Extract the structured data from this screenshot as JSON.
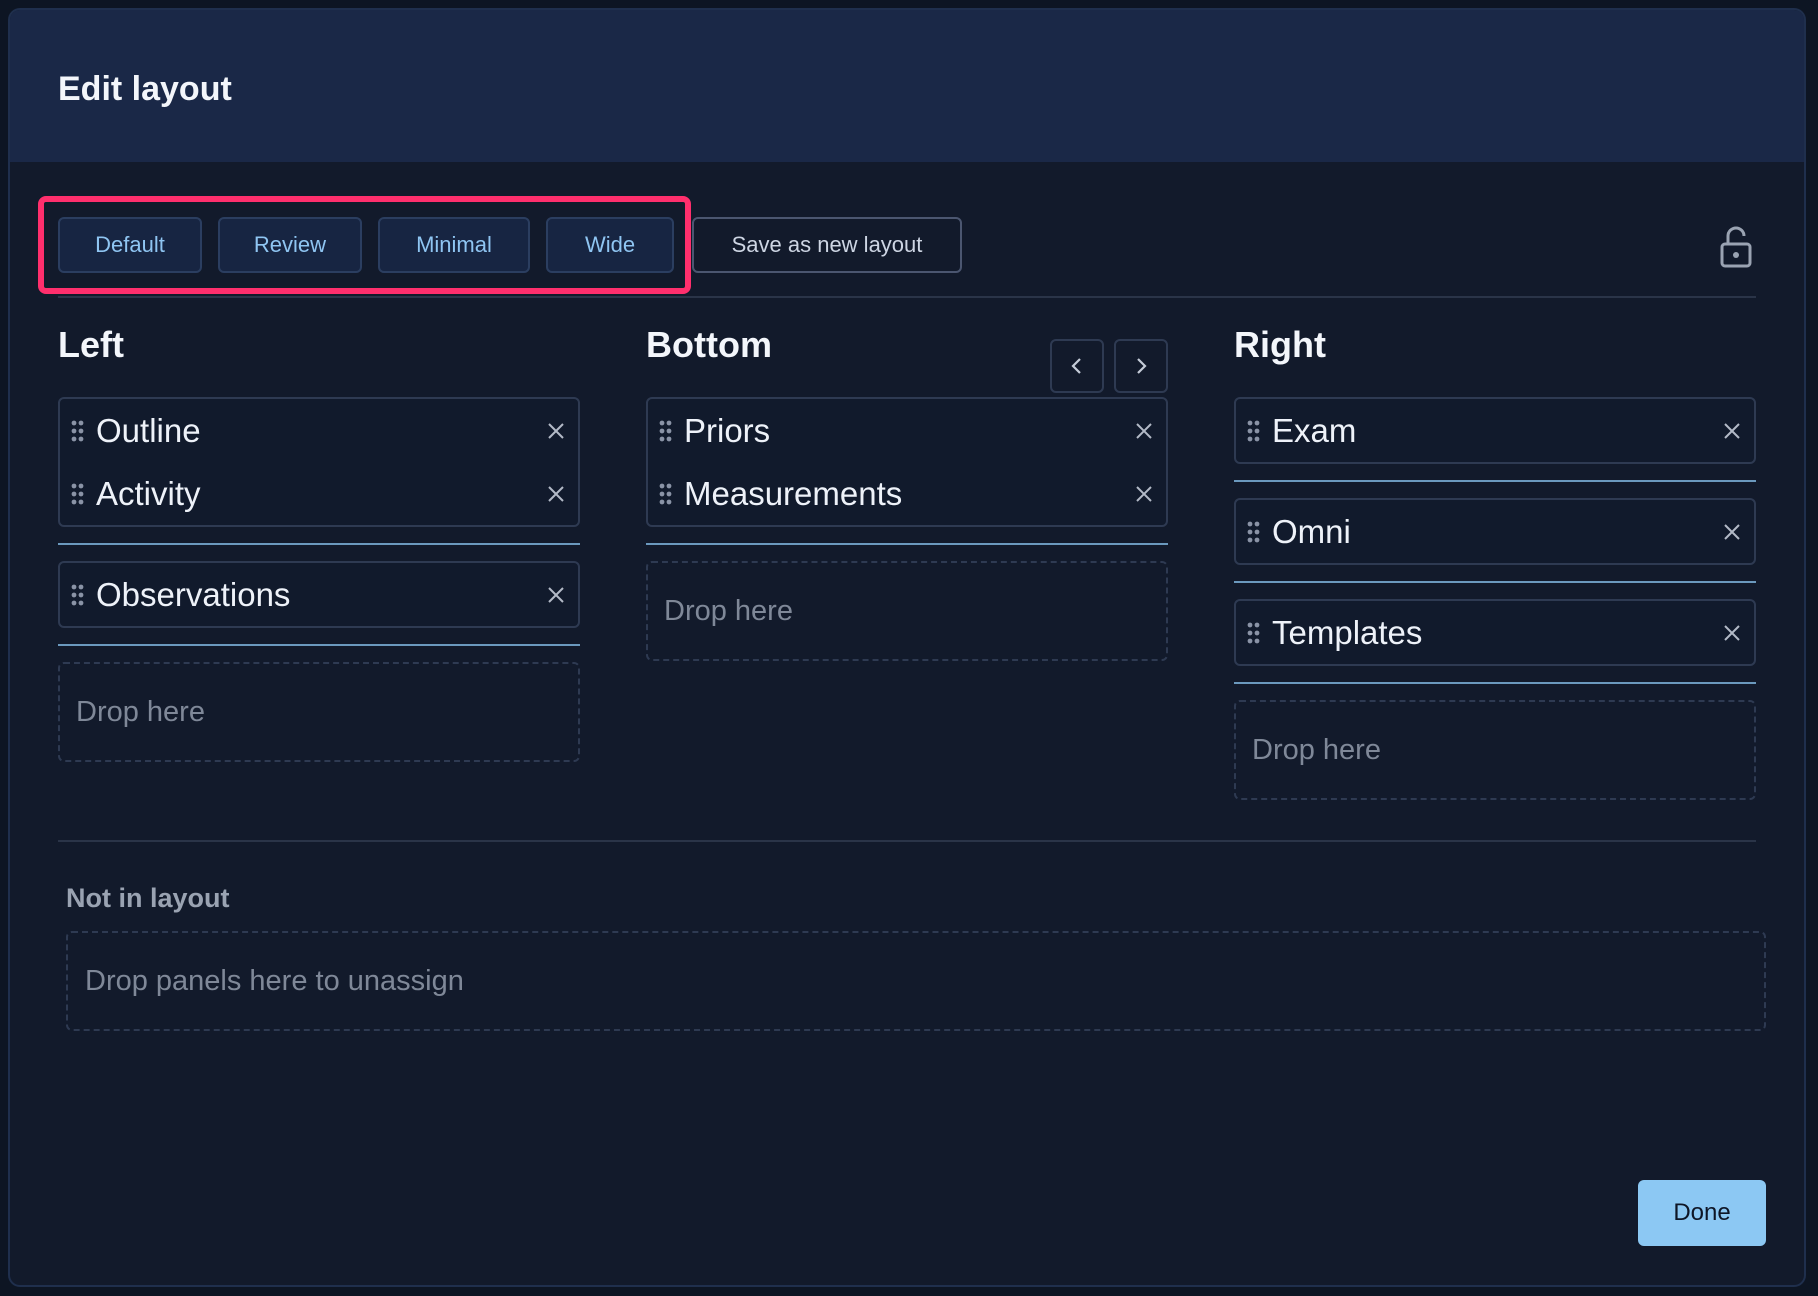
{
  "dialog": {
    "title": "Edit layout",
    "accent_color": "#ff2f6d",
    "done_label": "Done"
  },
  "toolbar": {
    "presets": [
      {
        "label": "Default"
      },
      {
        "label": "Review"
      },
      {
        "label": "Minimal"
      },
      {
        "label": "Wide"
      }
    ],
    "save_label": "Save as new layout",
    "lock_icon": "lock-open-icon"
  },
  "columns": {
    "left": {
      "title": "Left",
      "groups": [
        [
          "Outline",
          "Activity"
        ],
        [
          "Observations"
        ]
      ],
      "drop_label": "Drop here"
    },
    "bottom": {
      "title": "Bottom",
      "groups": [
        [
          "Priors",
          "Measurements"
        ]
      ],
      "drop_label": "Drop here"
    },
    "right": {
      "title": "Right",
      "groups": [
        [
          "Exam"
        ],
        [
          "Omni"
        ],
        [
          "Templates"
        ]
      ],
      "drop_label": "Drop here"
    }
  },
  "unassigned": {
    "title": "Not in layout",
    "drop_label": "Drop panels here to unassign"
  }
}
